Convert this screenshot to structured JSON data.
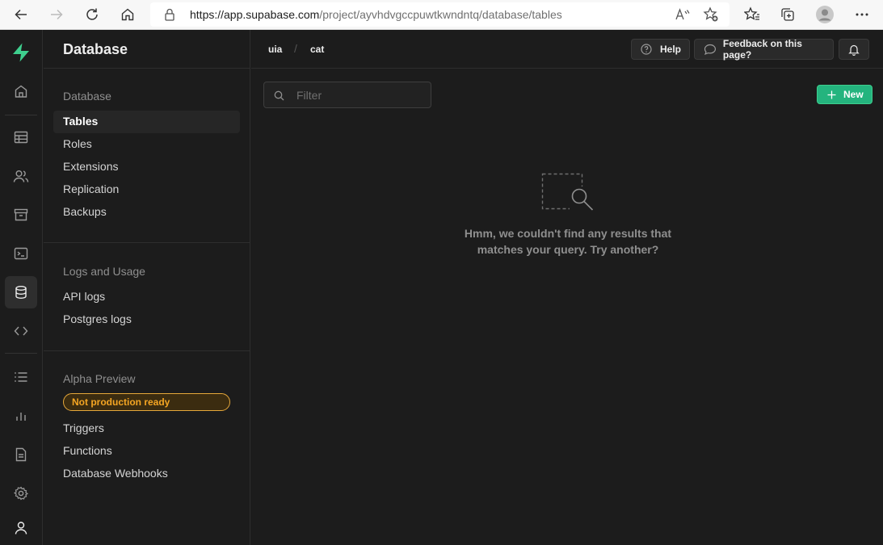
{
  "browser": {
    "url_host": "https://app.supabase.com",
    "url_path": "/project/ayvhdvgccpuwtkwndntq/database/tables"
  },
  "rail": {
    "items": [
      {
        "icon": "home-icon"
      },
      {
        "icon": "table-editor-icon"
      },
      {
        "icon": "users-icon"
      },
      {
        "icon": "storage-icon"
      },
      {
        "icon": "sql-editor-icon"
      },
      {
        "icon": "database-icon",
        "active": true
      },
      {
        "icon": "api-icon"
      },
      {
        "icon": "logs-icon"
      },
      {
        "icon": "reports-icon"
      },
      {
        "icon": "docs-icon"
      },
      {
        "icon": "settings-icon"
      },
      {
        "icon": "account-icon"
      }
    ]
  },
  "sidebar": {
    "title": "Database",
    "sections": {
      "database": {
        "label": "Database",
        "items": [
          "Tables",
          "Roles",
          "Extensions",
          "Replication",
          "Backups"
        ]
      },
      "logs": {
        "label": "Logs and Usage",
        "items": [
          "API logs",
          "Postgres logs"
        ]
      },
      "alpha": {
        "label": "Alpha Preview",
        "badge": "Not production ready",
        "items": [
          "Triggers",
          "Functions",
          "Database Webhooks"
        ]
      }
    }
  },
  "header": {
    "breadcrumb": [
      "uia",
      "/",
      "cat"
    ],
    "help_label": "Help",
    "feedback_label": "Feedback on this page?"
  },
  "main": {
    "filter_placeholder": "Filter",
    "new_label": "New",
    "empty_message": "Hmm, we couldn't find any results that matches your query. Try another?"
  },
  "colors": {
    "accent": "#3ecf8e",
    "badge": "#f5a623",
    "background": "#1c1c1c"
  }
}
